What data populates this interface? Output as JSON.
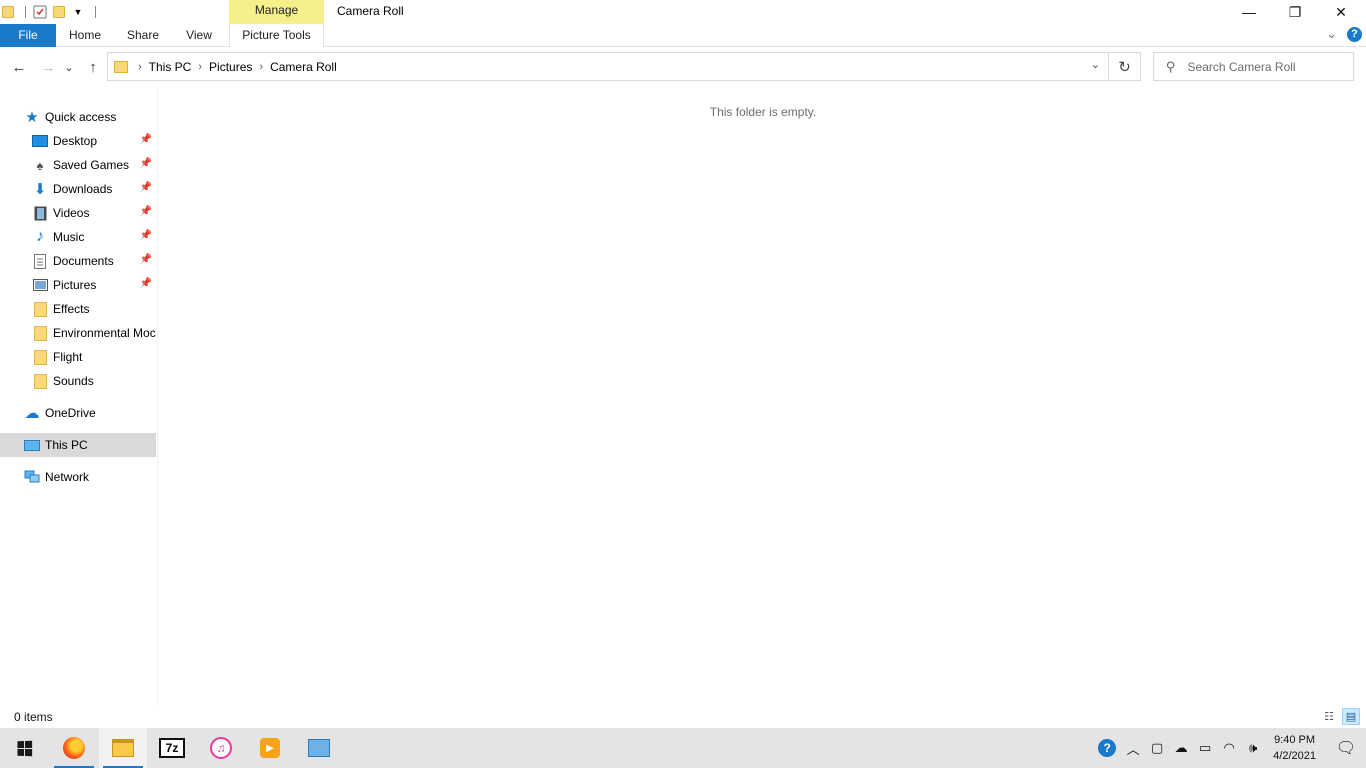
{
  "window": {
    "title": "Camera Roll",
    "minimize_glyph": "—",
    "maximize_glyph": "❐",
    "close_glyph": "✕"
  },
  "quick_access_toolbar": {
    "icons": [
      "folder-icon",
      "properties-icon",
      "new-folder-icon",
      "customize-dropdown-icon"
    ]
  },
  "ribbon": {
    "context_group": "Manage",
    "tabs": [
      {
        "label": "File"
      },
      {
        "label": "Home"
      },
      {
        "label": "Share"
      },
      {
        "label": "View"
      },
      {
        "label": "Picture Tools"
      }
    ],
    "help_label": "?",
    "expand_glyph": "⌄"
  },
  "navigation": {
    "back_glyph": "←",
    "forward_glyph": "→",
    "recent_glyph": "⌄",
    "up_glyph": "↑",
    "breadcrumbs": [
      "This PC",
      "Pictures",
      "Camera Roll"
    ],
    "refresh_glyph": "↻",
    "search_placeholder": "Search Camera Roll"
  },
  "sidebar": {
    "quick_access": {
      "label": "Quick access",
      "icon": "star-icon"
    },
    "items": [
      {
        "label": "Desktop",
        "icon": "desktop-icon",
        "pinned": true
      },
      {
        "label": "Saved Games",
        "icon": "saved-games-icon",
        "pinned": true
      },
      {
        "label": "Downloads",
        "icon": "download-icon",
        "pinned": true
      },
      {
        "label": "Videos",
        "icon": "videos-icon",
        "pinned": true
      },
      {
        "label": "Music",
        "icon": "music-icon",
        "pinned": true
      },
      {
        "label": "Documents",
        "icon": "documents-icon",
        "pinned": true
      },
      {
        "label": "Pictures",
        "icon": "pictures-icon",
        "pinned": true
      },
      {
        "label": "Effects",
        "icon": "folder-icon",
        "pinned": false
      },
      {
        "label": "Environmental Moc",
        "icon": "folder-icon",
        "pinned": false
      },
      {
        "label": "Flight",
        "icon": "folder-icon",
        "pinned": false
      },
      {
        "label": "Sounds",
        "icon": "folder-icon",
        "pinned": false
      }
    ],
    "onedrive": {
      "label": "OneDrive",
      "icon": "cloud-icon"
    },
    "this_pc": {
      "label": "This PC",
      "icon": "computer-icon",
      "selected": true
    },
    "network": {
      "label": "Network",
      "icon": "network-icon"
    }
  },
  "content": {
    "empty_message": "This folder is empty."
  },
  "statusbar": {
    "item_count": "0 items",
    "views": [
      "details-view-icon",
      "large-icons-view-icon"
    ]
  },
  "taskbar": {
    "apps": [
      {
        "name": "Firefox",
        "icon": "firefox-icon",
        "running": true
      },
      {
        "name": "File Explorer",
        "icon": "file-explorer-icon",
        "running": true,
        "active": true
      },
      {
        "name": "7-Zip",
        "icon": "7zip-icon",
        "label": "7z",
        "running": false
      },
      {
        "name": "iTunes",
        "icon": "itunes-icon",
        "running": false
      },
      {
        "name": "Media Player",
        "icon": "media-player-icon",
        "running": false
      },
      {
        "name": "Control Panel",
        "icon": "control-panel-icon",
        "running": false
      }
    ],
    "time": "9:40 PM",
    "date": "4/2/2021"
  },
  "colors": {
    "accent": "#1979ca",
    "context_tab": "#f5f08a",
    "selected_row": "#d9d9d9",
    "taskbar": "#e4e4e4"
  }
}
